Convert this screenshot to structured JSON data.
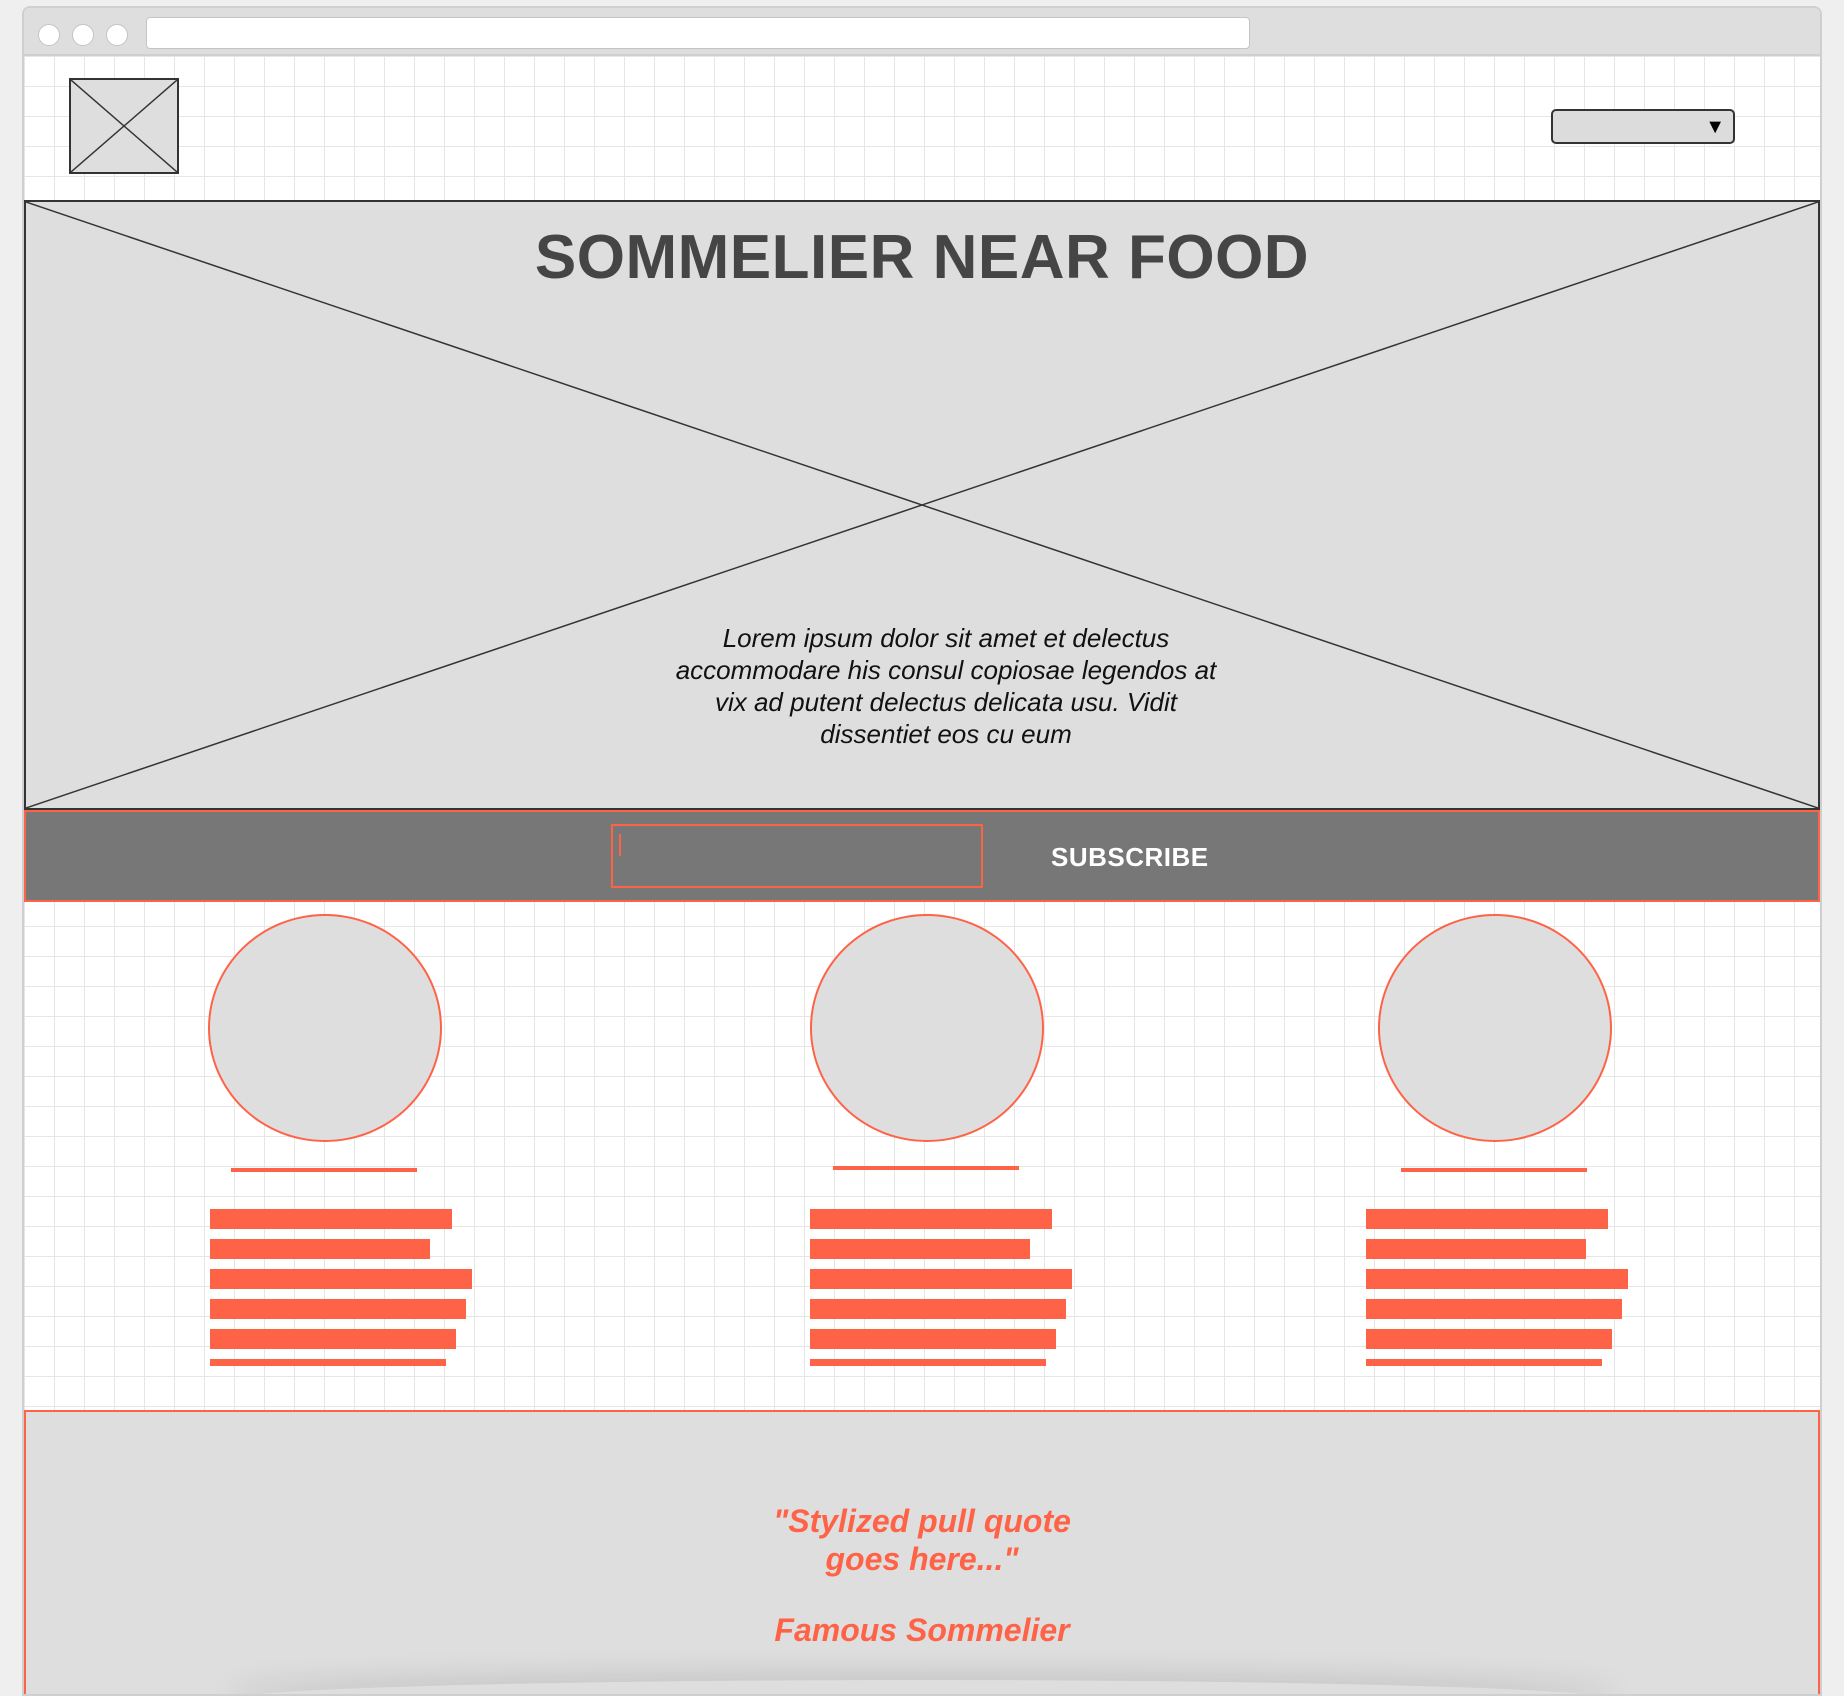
{
  "colors": {
    "accent": "#ff6347",
    "placeholder_fill": "#dedede",
    "bar_dark": "#777777",
    "title_text": "#454545"
  },
  "header": {
    "logo_icon": "image-placeholder-icon",
    "select_caret": "▼"
  },
  "hero": {
    "title": "SOMMELIER NEAR FOOD",
    "body": "Lorem ipsum dolor sit amet et delectus accommodare his consul copiosae legendos at vix ad putent delectus delicata usu. Vidit dissentiet eos cu eum"
  },
  "subscribe": {
    "input_value": "",
    "button_label": "SUBSCRIBE"
  },
  "team": {
    "cards": [
      {
        "avatar_icon": "avatar-placeholder"
      },
      {
        "avatar_icon": "avatar-placeholder"
      },
      {
        "avatar_icon": "avatar-placeholder"
      }
    ]
  },
  "quote": {
    "text": "\"Stylized pull quote\n goes here...\"",
    "author": "Famous Sommelier"
  }
}
